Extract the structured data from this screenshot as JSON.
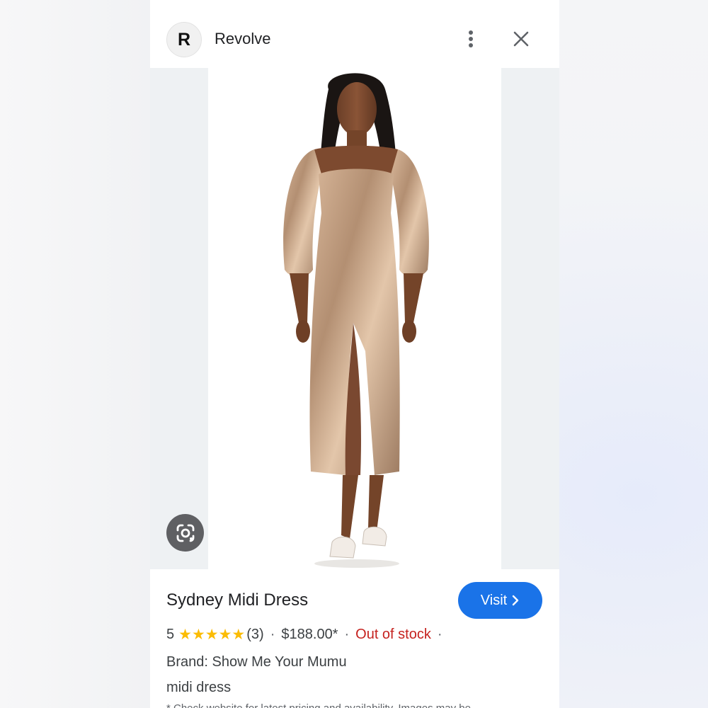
{
  "header": {
    "site_logo_letter": "R",
    "site_name": "Revolve"
  },
  "icons": {
    "more": "more-vert-icon",
    "close": "close-icon",
    "lens": "google-lens-icon",
    "visit_chevron": "chevron-right-icon"
  },
  "product": {
    "title": "Sydney Midi Dress",
    "rating": "5",
    "stars": "★★★★★",
    "review_count": "(3)",
    "price": "$188.00*",
    "availability": "Out of stock",
    "trailing_dot": "·",
    "brand": "Brand: Show Me Your Mumu",
    "category": "midi dress",
    "disclaimer": "* Check website for latest pricing and availability. Images may be"
  },
  "actions": {
    "visit_label": "Visit"
  },
  "colors": {
    "accent": "#1a73e8",
    "star": "#fbbc04",
    "out_of_stock": "#c5221f"
  }
}
